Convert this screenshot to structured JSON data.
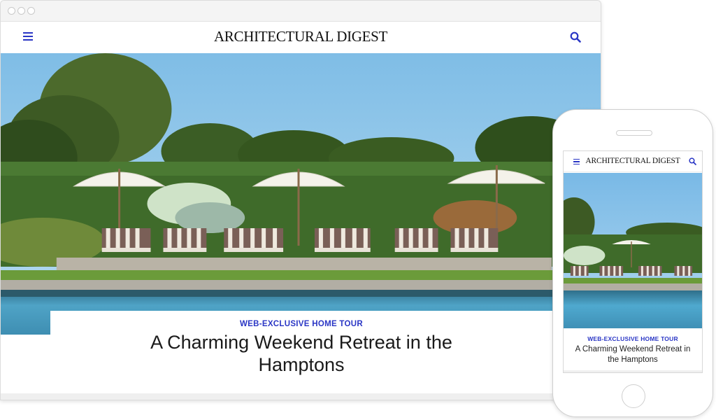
{
  "site": {
    "logo": "ARCHITECTURAL DIGEST"
  },
  "article": {
    "kicker": "WEB-EXCLUSIVE HOME TOUR",
    "headline": "A Charming Weekend Retreat in the Hamptons"
  },
  "icons": {
    "menu": "hamburger-menu-icon",
    "search": "search-icon"
  },
  "colors": {
    "accent": "#2a36c5",
    "sky": "#8fc6ea",
    "hedge": "#3f6b2a",
    "pool": "#3e9cc7"
  }
}
